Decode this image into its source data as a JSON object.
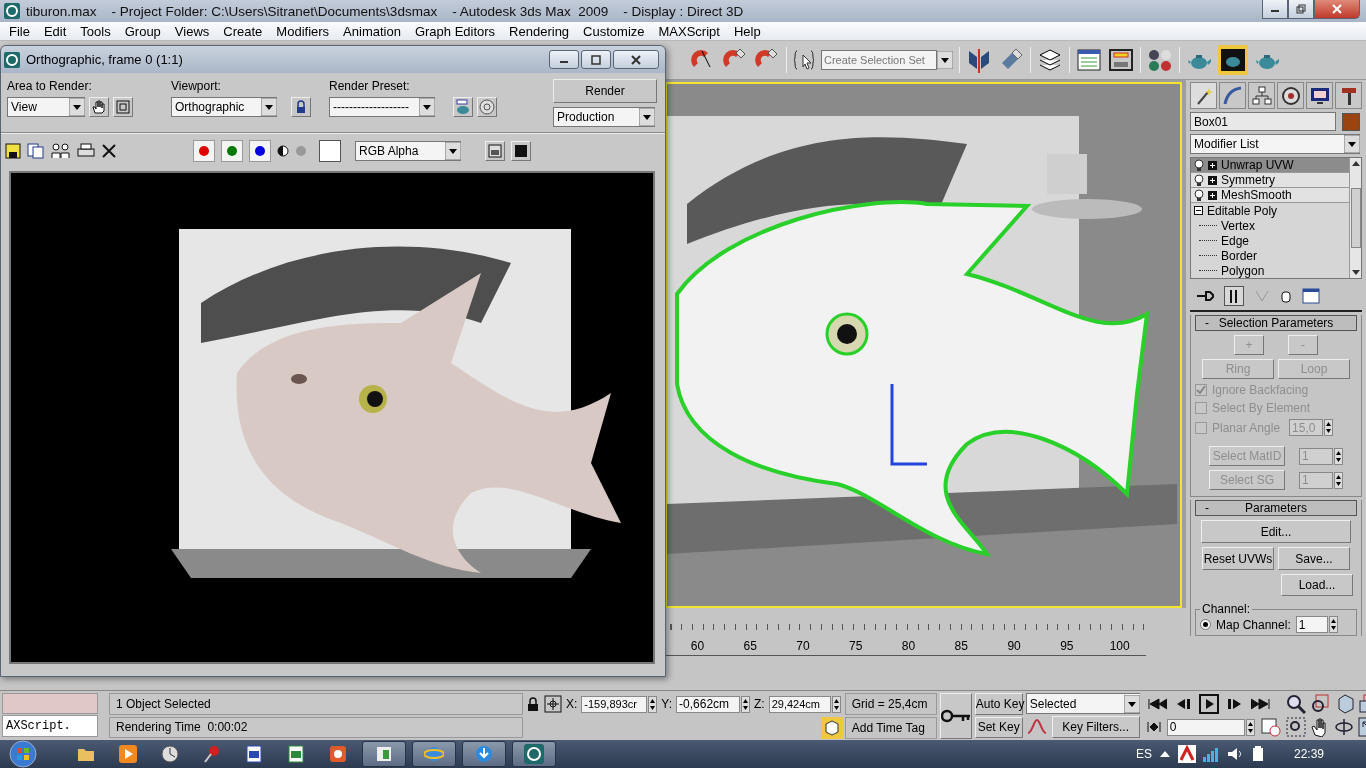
{
  "window": {
    "title": "tiburon.max    - Project Folder: C:\\Users\\Sitranet\\Documents\\3dsmax    - Autodesk 3ds Max  2009    - Display : Direct 3D"
  },
  "menu": [
    "File",
    "Edit",
    "Tools",
    "Group",
    "Views",
    "Create",
    "Modifiers",
    "Animation",
    "Graph Editors",
    "Rendering",
    "Customize",
    "MAXScript",
    "Help"
  ],
  "toolbar": {
    "selection_set": {
      "placeholder": "Create Selection Set"
    }
  },
  "render_window": {
    "title": "Orthographic, frame 0 (1:1)",
    "area_label": "Area to Render:",
    "area": "View",
    "viewport_label": "Viewport:",
    "viewport": "Orthographic",
    "preset_label": "Render Preset:",
    "preset": "-------------------",
    "render_button": "Render",
    "mode": "Production",
    "channel": "RGB Alpha"
  },
  "timeline": {
    "ticks": [
      "60",
      "65",
      "70",
      "75",
      "80",
      "85",
      "90",
      "95",
      "100"
    ]
  },
  "command_panel": {
    "object_name": "Box01",
    "modifier_list": "Modifier List",
    "stack": [
      {
        "label": "Unwrap UVW",
        "kind": "modifier",
        "selected": true,
        "expanded": false
      },
      {
        "label": "Symmetry",
        "kind": "modifier",
        "selected": false,
        "expanded": false
      },
      {
        "label": "MeshSmooth",
        "kind": "modifier",
        "selected": false,
        "expanded": false
      },
      {
        "label": "Editable Poly",
        "kind": "base",
        "selected": false,
        "expanded": true,
        "children": [
          {
            "label": "Vertex"
          },
          {
            "label": "Edge"
          },
          {
            "label": "Border"
          },
          {
            "label": "Polygon"
          }
        ]
      }
    ],
    "selection_rollout": {
      "collapse": "-",
      "title": "Selection Parameters",
      "disabled": true,
      "grow": "+",
      "shrink": "-",
      "ring": "Ring",
      "loop": "Loop",
      "checks": [
        {
          "label": "Ignore Backfacing",
          "checked": true
        },
        {
          "label": "Select By Element",
          "checked": false
        },
        {
          "label": "Planar Angle",
          "checked": false,
          "value": "15,0"
        }
      ],
      "matid_button": "Select MatID",
      "matid": "1",
      "sg_button": "Select SG",
      "sg": "1"
    },
    "parameters_rollout": {
      "collapse": "-",
      "title": "Parameters",
      "edit": "Edit...",
      "reset": "Reset UVWs",
      "save": "Save...",
      "load": "Load...",
      "group": "Channel:",
      "options": [
        {
          "label": "Map Channel:",
          "selected": true,
          "value": "1"
        }
      ]
    }
  },
  "status": {
    "script": "AXScript.",
    "prompt": "1 Object Selected",
    "info": "Rendering Time  0:00:02",
    "x_label": "X:",
    "x": "-159,893cr",
    "y_label": "Y:",
    "y": "-0,662cm",
    "z_label": "Z:",
    "z": "29,424cm",
    "grid": "Grid = 25,4cm",
    "time_tag": "Add Time Tag",
    "auto_key": "Auto Key",
    "set_key": "Set Key",
    "key_mode": "Selected",
    "key_filters": "Key Filters...",
    "frame": "0"
  },
  "taskbar": {
    "language": "ES",
    "clock": "22:39"
  }
}
